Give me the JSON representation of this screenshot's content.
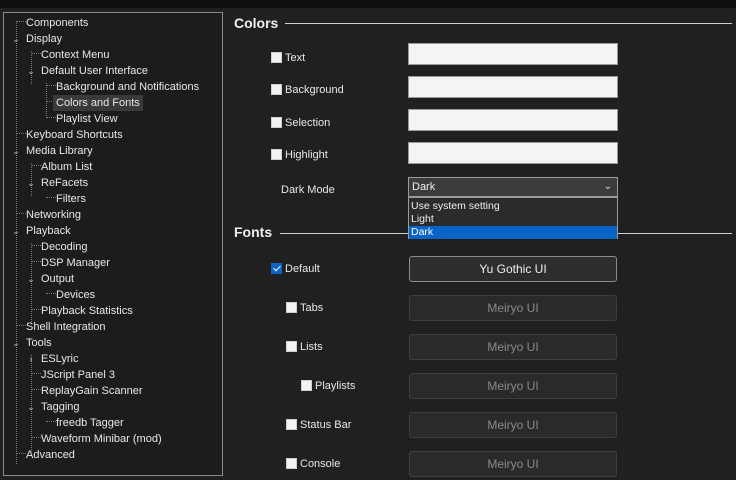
{
  "tree": {
    "items": [
      {
        "label": "Components"
      },
      {
        "label": "Display"
      },
      {
        "label": "Context Menu"
      },
      {
        "label": "Default User Interface"
      },
      {
        "label": "Background and Notifications"
      },
      {
        "label": "Colors and Fonts"
      },
      {
        "label": "Playlist View"
      },
      {
        "label": "Keyboard Shortcuts"
      },
      {
        "label": "Media Library"
      },
      {
        "label": "Album List"
      },
      {
        "label": "ReFacets"
      },
      {
        "label": "Filters"
      },
      {
        "label": "Networking"
      },
      {
        "label": "Playback"
      },
      {
        "label": "Decoding"
      },
      {
        "label": "DSP Manager"
      },
      {
        "label": "Output"
      },
      {
        "label": "Devices"
      },
      {
        "label": "Playback Statistics"
      },
      {
        "label": "Shell Integration"
      },
      {
        "label": "Tools"
      },
      {
        "label": "ESLyric"
      },
      {
        "label": "JScript Panel 3"
      },
      {
        "label": "ReplayGain Scanner"
      },
      {
        "label": "Tagging"
      },
      {
        "label": "freedb Tagger"
      },
      {
        "label": "Waveform Minibar (mod)"
      },
      {
        "label": "Advanced"
      }
    ]
  },
  "colors": {
    "title": "Colors",
    "text_label": "Text",
    "background_label": "Background",
    "selection_label": "Selection",
    "highlight_label": "Highlight",
    "dark_mode_label": "Dark Mode",
    "dark_mode_value": "Dark",
    "dark_mode_options": [
      "Use system setting",
      "Light",
      "Dark"
    ]
  },
  "fonts": {
    "title": "Fonts",
    "default_label": "Default",
    "default_font": "Yu Gothic UI",
    "tabs_label": "Tabs",
    "tabs_font": "Meiryo UI",
    "lists_label": "Lists",
    "lists_font": "Meiryo UI",
    "playlists_label": "Playlists",
    "playlists_font": "Meiryo UI",
    "statusbar_label": "Status Bar",
    "statusbar_font": "Meiryo UI",
    "console_label": "Console",
    "console_font": "Meiryo UI"
  },
  "theme": {
    "accent": "#0a64c8",
    "background": "#202020"
  }
}
